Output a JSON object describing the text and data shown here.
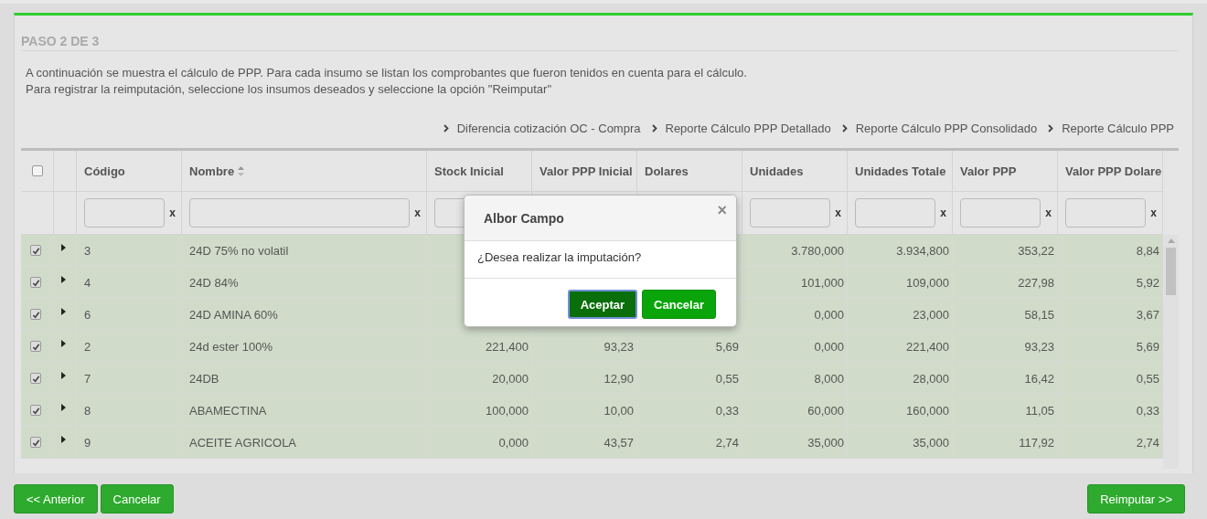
{
  "step_title": "PASO 2 DE 3",
  "instructions": [
    "A continuación se muestra el cálculo de PPP. Para cada insumo se listan los comprobantes que fueron tenidos en cuenta para el cálculo.",
    "Para registrar la reimputación, seleccione los insumos deseados y seleccione la opción \"Reimputar\""
  ],
  "report_links": [
    "Diferencia cotización OC - Compra",
    "Reporte Cálculo PPP Detallado",
    "Reporte Cálculo PPP Consolidado",
    "Reporte Cálculo PPP"
  ],
  "table": {
    "select_all": {
      "checked": false
    },
    "columns": [
      {
        "label": "Código",
        "filter_clear": "x"
      },
      {
        "label": "Nombre",
        "sort_icon": true,
        "filter_clear": "x"
      },
      {
        "label": "Stock Inicial"
      },
      {
        "label": "Valor PPP Inicial"
      },
      {
        "label": "Dolares"
      },
      {
        "label": "Unidades",
        "filter_clear": "x"
      },
      {
        "label": "Unidades Totale",
        "filter_clear": "x"
      },
      {
        "label": "Valor PPP",
        "filter_clear": "x"
      },
      {
        "label": "Valor PPP Dolare",
        "filter_clear": "x"
      }
    ],
    "rows": [
      {
        "checked": true,
        "cells": [
          "3",
          "24D 75% no volatil",
          null,
          null,
          null,
          "3.780,000",
          "3.934,800",
          "353,22",
          "8,84"
        ]
      },
      {
        "checked": true,
        "cells": [
          "4",
          "24D 84%",
          null,
          null,
          null,
          "101,000",
          "109,000",
          "227,98",
          "5,92"
        ]
      },
      {
        "checked": true,
        "cells": [
          "6",
          "24D AMINA 60%",
          null,
          null,
          null,
          "0,000",
          "23,000",
          "58,15",
          "3,67"
        ]
      },
      {
        "checked": true,
        "cells": [
          "2",
          "24d ester 100%",
          "221,400",
          "93,23",
          "5,69",
          "0,000",
          "221,400",
          "93,23",
          "5,69"
        ]
      },
      {
        "checked": true,
        "cells": [
          "7",
          "24DB",
          "20,000",
          "12,90",
          "0,55",
          "8,000",
          "28,000",
          "16,42",
          "0,55"
        ]
      },
      {
        "checked": true,
        "cells": [
          "8",
          "ABAMECTINA",
          "100,000",
          "10,00",
          "0,33",
          "60,000",
          "160,000",
          "11,05",
          "0,33"
        ]
      },
      {
        "checked": true,
        "cells": [
          "9",
          "ACEITE AGRICOLA",
          "0,000",
          "43,57",
          "2,74",
          "35,000",
          "35,000",
          "117,92",
          "2,74"
        ]
      }
    ]
  },
  "dialog": {
    "title": "Albor Campo",
    "close_label": "×",
    "message": "¿Desea realizar la imputación?",
    "buttons": [
      {
        "label": "Aceptar",
        "kind": "primary"
      },
      {
        "label": "Cancelar",
        "kind": "secondary"
      }
    ]
  },
  "footer": {
    "left_buttons": [
      "<< Anterior",
      "Cancelar"
    ],
    "right_buttons": [
      "Reimputar >>"
    ]
  }
}
